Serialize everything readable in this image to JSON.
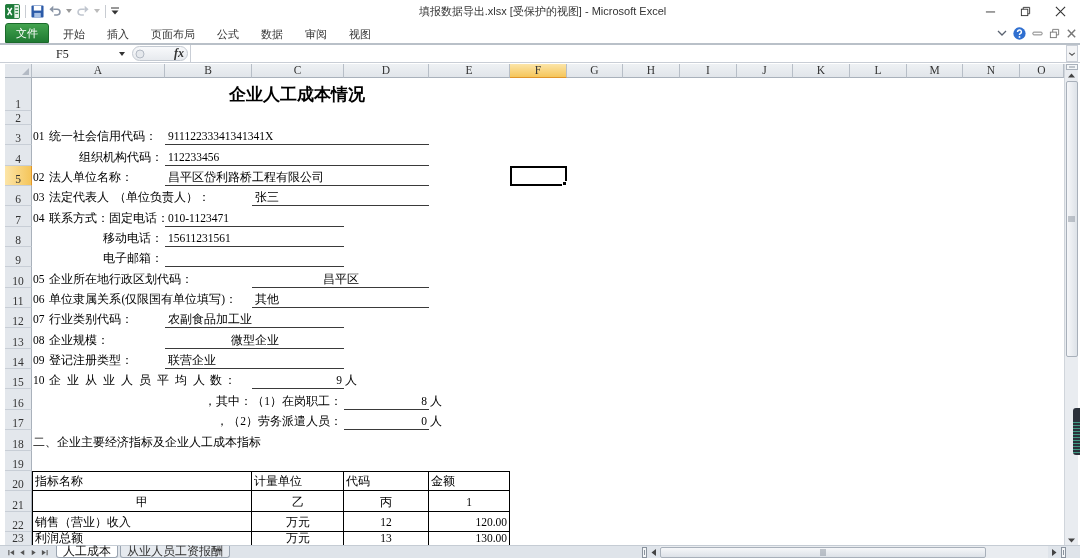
{
  "window": {
    "title": "填报数据导出.xlsx [受保护的视图] - Microsoft Excel"
  },
  "ribbon": {
    "file_tab": "文件",
    "tabs": [
      {
        "label": "开始",
        "selected": false
      },
      {
        "label": "插入",
        "selected": false
      },
      {
        "label": "页面布局",
        "selected": false
      },
      {
        "label": "公式",
        "selected": false
      },
      {
        "label": "数据",
        "selected": false
      },
      {
        "label": "审阅",
        "selected": false
      },
      {
        "label": "视图",
        "selected": false
      }
    ]
  },
  "formula_bar": {
    "name_box": "F5",
    "function_button": "fx"
  },
  "sheet": {
    "columns": [
      {
        "label": "A",
        "selected": false
      },
      {
        "label": "B",
        "selected": false
      },
      {
        "label": "C",
        "selected": false
      },
      {
        "label": "D",
        "selected": false
      },
      {
        "label": "E",
        "selected": false
      },
      {
        "label": "F",
        "selected": true
      },
      {
        "label": "G",
        "selected": false
      },
      {
        "label": "H",
        "selected": false
      },
      {
        "label": "I",
        "selected": false
      },
      {
        "label": "J",
        "selected": false
      },
      {
        "label": "K",
        "selected": false
      },
      {
        "label": "L",
        "selected": false
      },
      {
        "label": "M",
        "selected": false
      },
      {
        "label": "N",
        "selected": false
      },
      {
        "label": "O",
        "selected": false
      }
    ],
    "rows": [
      {
        "number": "1",
        "selected": false,
        "cells": [
          {
            "kind": "title",
            "text": "企业人工成本情况"
          }
        ]
      },
      {
        "number": "2",
        "selected": false
      },
      {
        "number": "3",
        "selected": false,
        "cells": [
          {
            "kind": "label",
            "text": "01 统一社会信用代码："
          },
          {
            "kind": "field",
            "text": "91112233341341341X"
          }
        ]
      },
      {
        "number": "4",
        "selected": false,
        "cells": [
          {
            "kind": "label",
            "text": "组织机构代码："
          },
          {
            "kind": "field",
            "text": "112233456"
          }
        ]
      },
      {
        "number": "5",
        "selected": true,
        "cells": [
          {
            "kind": "label",
            "text": "02 法人单位名称："
          },
          {
            "kind": "field",
            "text": "昌平区岱利路桥工程有限公司"
          }
        ]
      },
      {
        "number": "6",
        "selected": false,
        "cells": [
          {
            "kind": "label",
            "text": "03 法定代表人 （单位负责人）："
          },
          {
            "kind": "field",
            "text": "张三"
          }
        ]
      },
      {
        "number": "7",
        "selected": false,
        "cells": [
          {
            "kind": "label",
            "text": "04 联系方式：固定电话："
          },
          {
            "kind": "field",
            "text": "010-1123471"
          }
        ]
      },
      {
        "number": "8",
        "selected": false,
        "cells": [
          {
            "kind": "label",
            "text": "移动电话："
          },
          {
            "kind": "field",
            "text": "15611231561"
          }
        ]
      },
      {
        "number": "9",
        "selected": false,
        "cells": [
          {
            "kind": "label",
            "text": "电子邮箱："
          },
          {
            "kind": "field"
          }
        ]
      },
      {
        "number": "10",
        "selected": false,
        "cells": [
          {
            "kind": "label",
            "text": "05 企业所在地行政区划代码："
          },
          {
            "kind": "field",
            "text": "昌平区"
          }
        ]
      },
      {
        "number": "11",
        "selected": false,
        "cells": [
          {
            "kind": "label",
            "text": "06 单位隶属关系(仅限国有单位填写)："
          },
          {
            "kind": "field",
            "text": "其他"
          }
        ]
      },
      {
        "number": "12",
        "selected": false,
        "cells": [
          {
            "kind": "label",
            "text": "07 行业类别代码："
          },
          {
            "kind": "field",
            "text": "农副食品加工业"
          }
        ]
      },
      {
        "number": "13",
        "selected": false,
        "cells": [
          {
            "kind": "label",
            "text": "08 企业规模："
          },
          {
            "kind": "field",
            "text": "微型企业"
          }
        ]
      },
      {
        "number": "14",
        "selected": false,
        "cells": [
          {
            "kind": "label",
            "text": "09 登记注册类型："
          },
          {
            "kind": "field",
            "text": "联营企业"
          }
        ]
      },
      {
        "number": "15",
        "selected": false,
        "cells": [
          {
            "kind": "label",
            "text": "10 企 业 从 业 人 员 平 均 人 数："
          },
          {
            "kind": "field",
            "text": "9"
          },
          {
            "kind": "label",
            "text": "人"
          }
        ]
      },
      {
        "number": "16",
        "selected": false,
        "cells": [
          {
            "kind": "label",
            "text": "，其中：（1）在岗职工："
          },
          {
            "kind": "field",
            "text": "8"
          },
          {
            "kind": "label",
            "text": "人"
          }
        ]
      },
      {
        "number": "17",
        "selected": false,
        "cells": [
          {
            "kind": "label",
            "text": "，（2）劳务派遣人员："
          },
          {
            "kind": "field",
            "text": "0"
          },
          {
            "kind": "label",
            "text": "人"
          }
        ]
      },
      {
        "number": "18",
        "selected": false,
        "cells": [
          {
            "kind": "heading",
            "text": "二、企业主要经济指标及企业人工成本指标"
          }
        ]
      },
      {
        "number": "19",
        "selected": false
      },
      {
        "number": "20",
        "selected": false,
        "cells": [
          {
            "kind": "table_head",
            "text": "指标名称"
          },
          {
            "kind": "table_head",
            "text": "计量单位"
          },
          {
            "kind": "table_head",
            "text": "代码"
          },
          {
            "kind": "table_head",
            "text": "金额"
          }
        ]
      },
      {
        "number": "21",
        "selected": false,
        "cells": [
          {
            "kind": "table_cell",
            "text": "甲"
          },
          {
            "kind": "table_cell",
            "text": "乙"
          },
          {
            "kind": "table_cell",
            "text": "丙"
          },
          {
            "kind": "table_cell",
            "text": "1"
          }
        ]
      },
      {
        "number": "22",
        "selected": false,
        "cells": [
          {
            "kind": "table_cell",
            "text": "销售（营业）收入"
          },
          {
            "kind": "table_cell",
            "text": "万元"
          },
          {
            "kind": "table_cell",
            "text": "12"
          },
          {
            "kind": "table_cell",
            "text": "120.00"
          }
        ]
      },
      {
        "number": "23",
        "selected": false,
        "cells": [
          {
            "kind": "table_cell",
            "text": "利润总额"
          },
          {
            "kind": "table_cell",
            "text": "万元"
          },
          {
            "kind": "table_cell",
            "text": "13"
          },
          {
            "kind": "table_cell",
            "text": "130.00"
          }
        ]
      }
    ]
  },
  "sheet_tabs": [
    {
      "label": "人工成本",
      "selected": true
    },
    {
      "label": "从业人员工资报酬",
      "selected": false
    }
  ]
}
